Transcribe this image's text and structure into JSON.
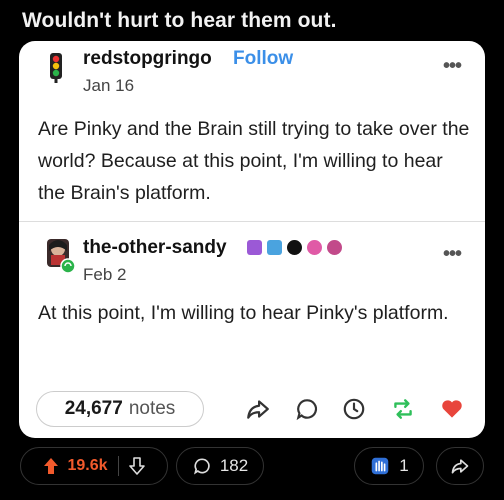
{
  "post": {
    "title": "Wouldn't hurt to hear them out."
  },
  "card": {
    "op": {
      "username": "redstopgringo",
      "follow_label": "Follow",
      "date": "Jan 16",
      "text": "Are Pinky and the Brain still trying to take over the world? Because at this point, I'm willing to hear the Brain's platform."
    },
    "reply": {
      "username": "the-other-sandy",
      "date": "Feb 2",
      "text": "At this point, I'm willing to hear Pinky's platform."
    },
    "notes": {
      "count": "24,677",
      "label": "notes"
    },
    "more_glyph": "•••"
  },
  "bar": {
    "upvotes": "19.6k",
    "comments": "182",
    "awards": "1"
  },
  "colors": {
    "follow": "#3b8fe8",
    "upvote": "#f25a2c",
    "reblog": "#2fbf5a",
    "heart": "#e8453c"
  }
}
